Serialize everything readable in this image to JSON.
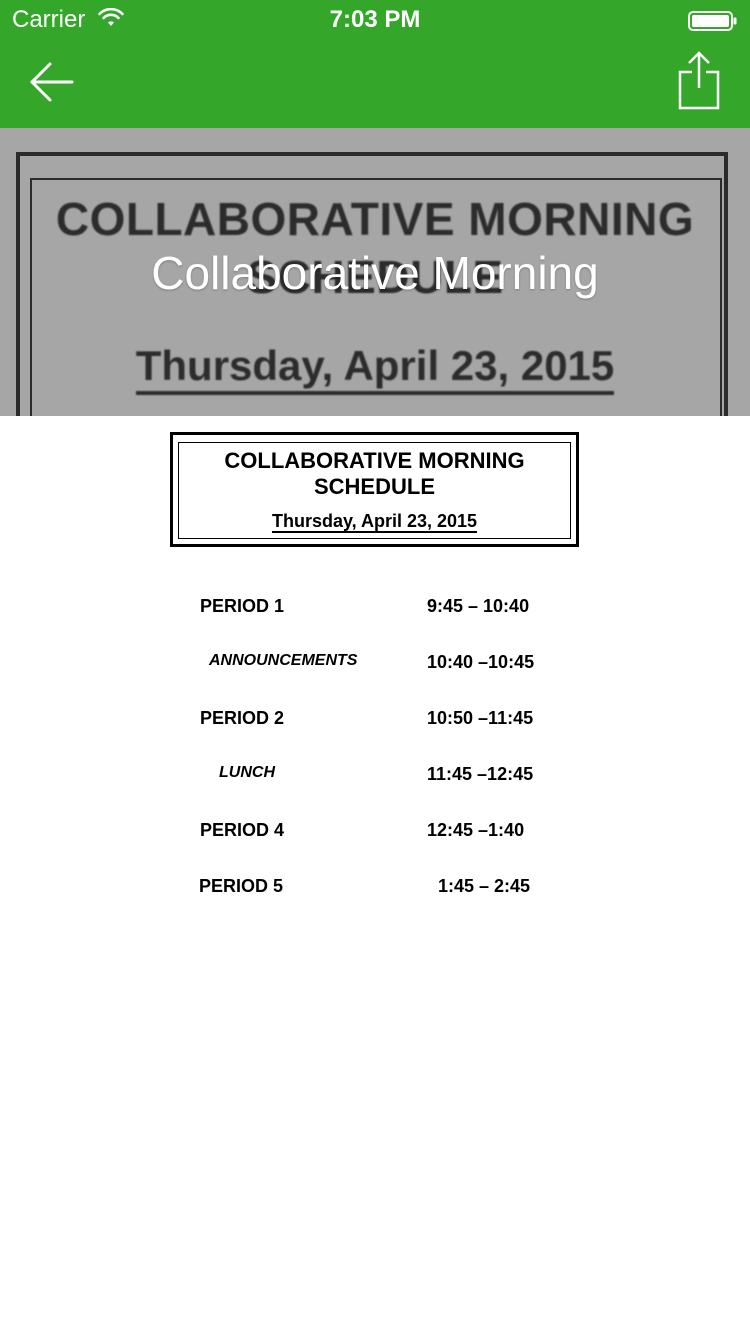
{
  "status_bar": {
    "carrier": "Carrier",
    "time": "7:03 PM"
  },
  "nav": {
    "back_icon": "arrow-left-icon",
    "share_icon": "share-icon",
    "accent_color": "#34a72b"
  },
  "hero": {
    "image_title": "COLLABORATIVE MORNING SCHEDULE",
    "image_date": "Thursday, April 23, 2015",
    "caption": "Collaborative Morning"
  },
  "document": {
    "title_line1": "COLLABORATIVE MORNING",
    "title_line2": "SCHEDULE",
    "date": "Thursday, April 23, 2015",
    "schedule": [
      {
        "label": "PERIOD  1",
        "time": "9:45 –  10:40"
      },
      {
        "label": "ANNOUNCEMENTS",
        "time": "10:40 –10:45"
      },
      {
        "label": "PERIOD 2",
        "time": "10:50 –11:45"
      },
      {
        "label": "LUNCH",
        "time": "11:45 –12:45"
      },
      {
        "label": "PERIOD 4",
        "time": "12:45 –1:40"
      },
      {
        "label": "PERIOD 5",
        "time": "1:45 – 2:45"
      }
    ]
  }
}
